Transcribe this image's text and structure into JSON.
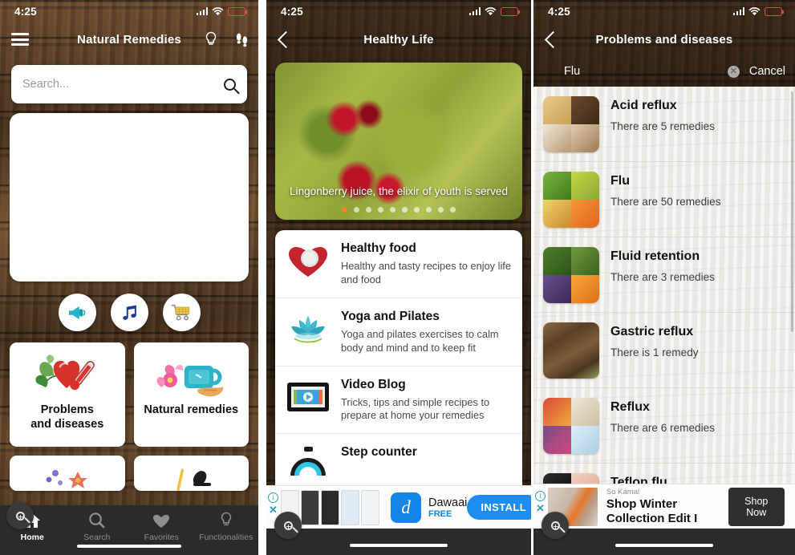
{
  "colors": {
    "accent_orange": "#f18225",
    "install_blue": "#1f8cf0",
    "tabbar_dark": "#2b2b2b",
    "battery_red": "#e0503f",
    "shop_button": "#2f2f2f"
  },
  "panel1": {
    "status": {
      "time": "4:25",
      "signal_icon": "cellular-signal-icon",
      "wifi_icon": "wifi-icon",
      "battery_icon": "battery-low-icon"
    },
    "nav": {
      "menu_icon": "hamburger-menu-icon",
      "title": "Natural Remedies",
      "bulb_icon": "lightbulb-icon",
      "steps_icon": "footsteps-icon"
    },
    "search": {
      "placeholder": "Search...",
      "value": "",
      "icon": "search-icon"
    },
    "quick_circles": [
      {
        "name": "megaphone-icon",
        "glyph": "📣"
      },
      {
        "name": "music-note-icon",
        "glyph": "🎵"
      },
      {
        "name": "shopping-cart-icon",
        "glyph": "🛒"
      }
    ],
    "tiles": [
      {
        "label": "Problems\nand diseases",
        "icon": "heart-thermometer-icon",
        "glyph": "🌿❤️🌡️"
      },
      {
        "label": "Natural remedies",
        "icon": "teacup-flowers-icon",
        "glyph": "🌸🫖🫕"
      }
    ],
    "tiles_partial": [
      {
        "icon": "flowers-icon",
        "glyph": "🌼🌺"
      },
      {
        "icon": "honey-dipper-icon",
        "glyph": "🍯🥄"
      }
    ],
    "tabs": [
      {
        "label": "Home",
        "icon": "home-icon",
        "active": true
      },
      {
        "label": "Search",
        "icon": "search-icon",
        "active": false
      },
      {
        "label": "Favorites",
        "icon": "heart-icon",
        "active": false
      },
      {
        "label": "Functionalities",
        "icon": "lightbulb-icon",
        "active": false
      }
    ],
    "zoom_overlay_icon": "zoom-in-icon"
  },
  "panel2": {
    "status": {
      "time": "4:25"
    },
    "nav": {
      "back_icon": "back-chevron-icon",
      "title": "Healthy Life"
    },
    "hero": {
      "image": "lingonberry-photo",
      "caption": "Lingonberry juice, the elixir of youth is served",
      "dots_total": 10,
      "dots_active_index": 0
    },
    "list": [
      {
        "title": "Healthy food",
        "desc": "Healthy and tasty recipes to enjoy life and food",
        "icon": "heart-plate-icon",
        "glyph": "❤️"
      },
      {
        "title": "Yoga and Pilates",
        "desc": "Yoga and pilates exercises to calm body and mind and to keep fit",
        "icon": "lotus-flower-icon",
        "glyph": "🪷"
      },
      {
        "title": "Video Blog",
        "desc": "Tricks, tips and simple recipes to prepare at home your remedies",
        "icon": "video-player-icon",
        "glyph": "📺"
      },
      {
        "title": "Step counter",
        "desc": "",
        "icon": "pedometer-icon",
        "glyph": "⏱️"
      }
    ],
    "ad": {
      "info_icon": "ad-info-icon",
      "close_icon": "ad-close-icon",
      "app_name": "Dawaai",
      "price": "FREE",
      "logo_letter": "d",
      "cta": "INSTALL"
    },
    "zoom_overlay_icon": "zoom-in-icon"
  },
  "panel3": {
    "status": {
      "time": "4:25"
    },
    "nav": {
      "back_icon": "back-chevron-icon",
      "title": "Problems and diseases"
    },
    "search": {
      "value": "Flu",
      "clear_icon": "clear-text-icon",
      "cancel_label": "Cancel"
    },
    "results": [
      {
        "title": "Acid reflux",
        "subtitle": "There are 5 remedies",
        "thumb": "ginger-coconut-collage"
      },
      {
        "title": "Flu",
        "subtitle": "There are 50 remedies",
        "thumb": "vegetables-tea-orange-collage"
      },
      {
        "title": "Fluid retention",
        "subtitle": "There are 3 remedies",
        "thumb": "plum-orange-collage"
      },
      {
        "title": "Gastric reflux",
        "subtitle": "There is 1 remedy",
        "thumb": "bark-herbs-photo"
      },
      {
        "title": "Reflux",
        "subtitle": "There are 6 remedies",
        "thumb": "fruit-water-collage"
      },
      {
        "title": "Teflon flu",
        "subtitle": "",
        "thumb": "pan-food-collage"
      }
    ],
    "ad": {
      "info_icon": "ad-info-icon",
      "close_icon": "ad-close-icon",
      "brand": "So Kamal",
      "headline": "Shop Winter Collection Edit I",
      "cta": "Shop Now"
    },
    "zoom_overlay_icon": "zoom-in-icon"
  }
}
